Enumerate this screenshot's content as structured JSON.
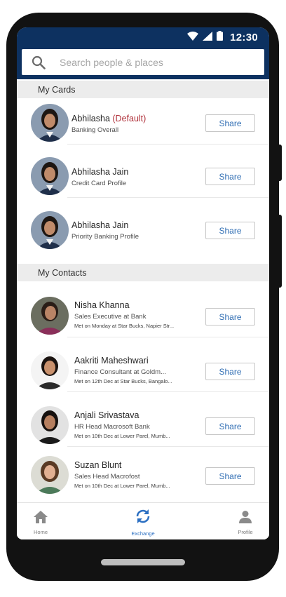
{
  "status_bar": {
    "time": "12:30"
  },
  "search": {
    "placeholder": "Search people & places"
  },
  "sections": {
    "my_cards": "My Cards",
    "my_contacts": "My Contacts"
  },
  "cards": [
    {
      "name": "Abhilasha",
      "tag": "(Default)",
      "subtitle": "Banking Overall",
      "share_label": "Share"
    },
    {
      "name": "Abhilasha Jain",
      "tag": "",
      "subtitle": "Credit Card Profile",
      "share_label": "Share"
    },
    {
      "name": "Abhilasha Jain",
      "tag": "",
      "subtitle": "Priority Banking Profile",
      "share_label": "Share"
    }
  ],
  "contacts": [
    {
      "name": "Nisha Khanna",
      "title": "Sales Executive at Bank",
      "met": "Met on Monday at Star Bucks, Napier Str...",
      "share_label": "Share"
    },
    {
      "name": "Aakriti Maheshwari",
      "title": "Finance Consultant at Goldm...",
      "met": "Met on 12th Dec at Star Bucks, Bangalo...",
      "share_label": "Share"
    },
    {
      "name": "Anjali Srivastava",
      "title": "HR Head Macrosoft Bank",
      "met": "Met on 10th Dec at Lower Parel, Mumb...",
      "share_label": "Share"
    },
    {
      "name": "Suzan Blunt",
      "title": "Sales Head Macrofost",
      "met": "Met on 10th Dec at Lower Parel, Mumb...",
      "share_label": "Share"
    }
  ],
  "bottom_nav": [
    {
      "label": "Home",
      "icon": "home-icon",
      "active": false
    },
    {
      "label": "Exchange",
      "icon": "sync-icon",
      "active": true
    },
    {
      "label": "Profile",
      "icon": "person-icon",
      "active": false
    }
  ],
  "colors": {
    "app_bar": "#0d3160",
    "accent": "#2f6db3",
    "default_tag": "#b0303a",
    "section_bg": "#ececec"
  }
}
